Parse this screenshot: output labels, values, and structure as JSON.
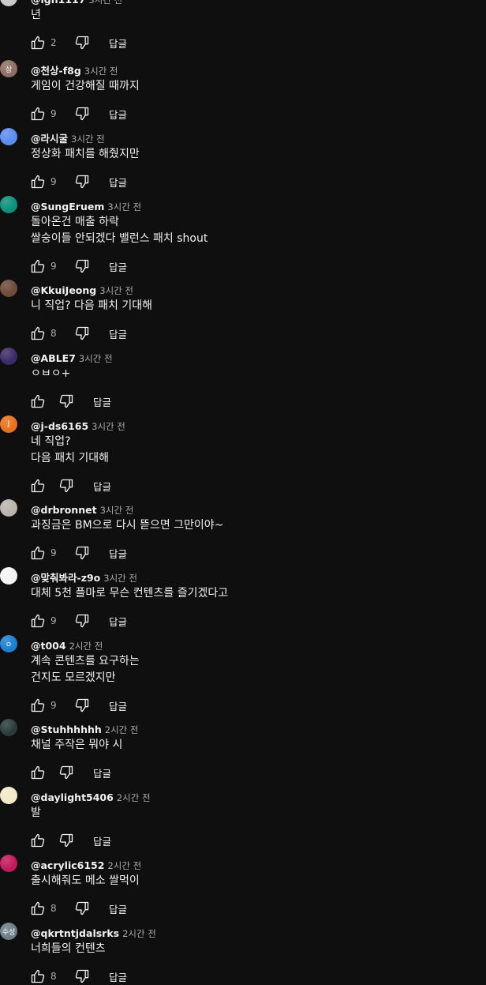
{
  "dislike_icon": "thumbs-down-icon",
  "like_icon": "thumbs-up-icon",
  "reply_label": "답글",
  "comments": [
    {
      "author": "@lgh1117",
      "time": "3시간 전",
      "text": "년",
      "likes": "2",
      "avatar": {
        "bg": "#c8c8c8",
        "letter": ""
      }
    },
    {
      "author": "@천상-f8g",
      "time": "3시간 전",
      "text": "게임이 건강해질 때까지",
      "likes": "9",
      "avatar": {
        "bg": "#8d6e63",
        "letter": "상"
      }
    },
    {
      "author": "@라시굴",
      "time": "3시간 전",
      "text": "정상화 패치를 해줬지만",
      "likes": "9",
      "avatar": {
        "bg": "#5b8def",
        "letter": ""
      }
    },
    {
      "author": "@SungEruem",
      "time": "3시간 전",
      "text": "돌아온건 매출 하락\n쌀숭이들 안되겠다 밸런스 패치 shout",
      "likes": "9",
      "avatar": {
        "bg": "#0b8f7a",
        "letter": ""
      }
    },
    {
      "author": "@KkuiJeong",
      "time": "3시간 전",
      "text": "니 직업? 다음 패치 기대해",
      "likes": "8",
      "avatar": {
        "bg": "#6d4a3a",
        "letter": ""
      }
    },
    {
      "author": "@ABLE7",
      "time": "3시간 전",
      "text": "ㅇㅂㅇ+",
      "likes": "",
      "avatar": {
        "bg": "#3b2a66",
        "letter": ""
      }
    },
    {
      "author": "@j-ds6165",
      "time": "3시간 전",
      "text": "네 직업?\n다음 패치 기대해",
      "likes": "",
      "avatar": {
        "bg": "#e8711a",
        "letter": "J"
      }
    },
    {
      "author": "@drbronnet",
      "time": "3시간 전",
      "text": "과징금은 BM으로 다시 뜯으면 그만이야~",
      "likes": "9",
      "avatar": {
        "bg": "#b9b3ad",
        "letter": ""
      }
    },
    {
      "author": "@맞춰봐라-z9o",
      "time": "3시간 전",
      "text": "대체 5천 플마로 무슨 컨텐츠를 즐기겠다고",
      "likes": "9",
      "avatar": {
        "bg": "#f4f4f4",
        "letter": ""
      }
    },
    {
      "author": "@t004",
      "time": "2시간 전",
      "text": "계속 콘텐츠를 요구하는\n건지도 모르겠지만",
      "likes": "9",
      "avatar": {
        "bg": "#1c7fd1",
        "letter": "ㅇ"
      }
    },
    {
      "author": "@Stuhhhhhh",
      "time": "2시간 전",
      "text": "채널 주작은 뭐야 시",
      "likes": "",
      "avatar": {
        "bg": "#2a3a3a",
        "letter": ""
      }
    },
    {
      "author": "@daylight5406",
      "time": "2시간 전",
      "text": "발",
      "likes": "",
      "avatar": {
        "bg": "#f2e9c9",
        "letter": ""
      }
    },
    {
      "author": "@acrylic6152",
      "time": "2시간 전",
      "text": "출시해줘도 메소 쌀먹이",
      "likes": "8",
      "avatar": {
        "bg": "#c2185b",
        "letter": ""
      }
    },
    {
      "author": "@qkrtntjdalsrks",
      "time": "2시간 전",
      "text": "너희들의 컨텐츠",
      "likes": "8",
      "avatar": {
        "bg": "#6b7d86",
        "letter": "수성"
      }
    }
  ]
}
